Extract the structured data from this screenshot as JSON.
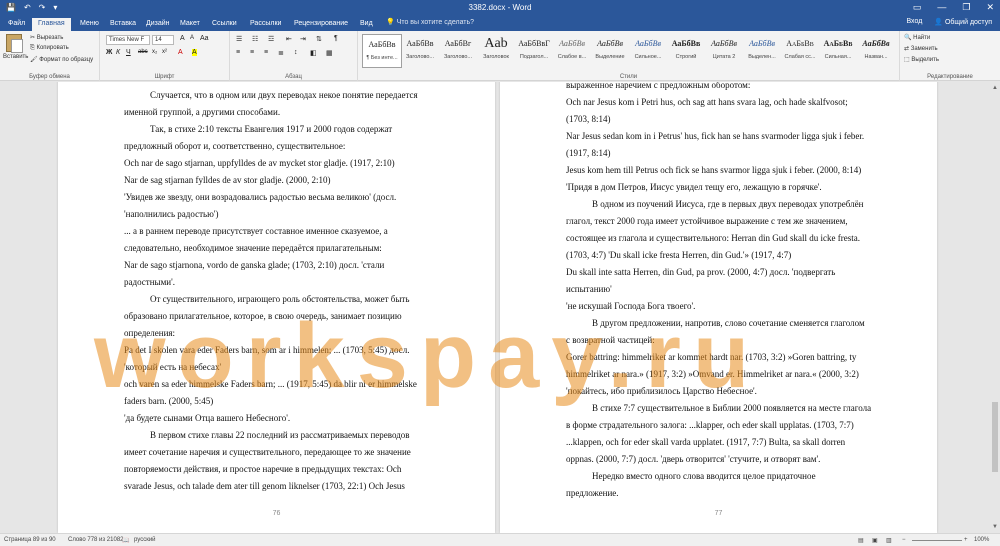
{
  "titlebar": {
    "doc_title": "3382.docx - Word",
    "qat": [
      "💾",
      "↶",
      "↷",
      "▾"
    ],
    "controls": [
      "▭",
      "—",
      "❐",
      "✕"
    ]
  },
  "tabs": [
    "Файл",
    "Главная",
    "Меню",
    "Вставка",
    "Дизайн",
    "Макет",
    "Ссылки",
    "Рассылки",
    "Рецензирование",
    "Вид"
  ],
  "tell_me": "Что вы хотите сделать?",
  "account": {
    "signin": "Вход",
    "share": "Общий доступ"
  },
  "ribbon": {
    "clipboard": {
      "paste": "Вставить",
      "cut": "Вырезать",
      "copy": "Копировать",
      "format": "Формат по образцу",
      "group": "Буфер обмена"
    },
    "font": {
      "name": "Times New F",
      "size": "14",
      "group": "Шрифт",
      "buttons": [
        "Ж",
        "К",
        "Ч",
        "abc",
        "x₂",
        "x²",
        "A",
        "A"
      ]
    },
    "paragraph": {
      "group": "Абзац"
    },
    "styles": {
      "group": "Стили",
      "items": [
        {
          "preview": "АаБбВв",
          "label": "¶ Без инте..."
        },
        {
          "preview": "АаБбВв",
          "label": "Заголово..."
        },
        {
          "preview": "АаБбВг",
          "label": "Заголово..."
        },
        {
          "preview": "Aab",
          "label": "Заголовок"
        },
        {
          "preview": "АаБбВвГ",
          "label": "Подзагол..."
        },
        {
          "preview": "АаБбВв",
          "label": "Слабое в..."
        },
        {
          "preview": "АаБбВв",
          "label": "Выделение"
        },
        {
          "preview": "АаБбВв",
          "label": "Сильное..."
        },
        {
          "preview": "АаБбВв",
          "label": "Строгий"
        },
        {
          "preview": "АаБбВв",
          "label": "Цитата 2"
        },
        {
          "preview": "АаБбВв",
          "label": "Выделен..."
        },
        {
          "preview": "АаБбВв",
          "label": "Слабая сс..."
        },
        {
          "preview": "АаБбВв",
          "label": "Сильная..."
        },
        {
          "preview": "АаБбВв",
          "label": "Назван..."
        }
      ]
    },
    "editing": {
      "find": "Найти",
      "replace": "Заменить",
      "select": "Выделить",
      "group": "Редактирование"
    }
  },
  "page_left": {
    "number": "76",
    "lines": [
      "Случается, что в одном или двух переводах некое понятие передается",
      "именной группой, а другими способами.",
      "Так, в стихе 2:10 тексты Евангелия 1917 и 2000 годов содержат",
      "предложный оборот и, соответственно, существительное:",
      "Och nar de sago stjarnan, uppfylldes de av mycket stor gladje. (1917, 2:10)",
      "Nar de sag stjarnan fylldes de av stor gladje. (2000, 2:10)",
      "'Увидев же звезду, они возрадовались радостью весьма великою' (досл.",
      "'наполнились радостью')",
      "... а в раннем переводе присутствует составное именное сказуемое, а",
      "следовательно, необходимое значение передаётся прилагательным:",
      "Nar de sago stjarnona, vordo de ganska glade; (1703, 2:10) досл. 'стали",
      "радостными'.",
      "От существительного, играющего роль обстоятельства, может быть",
      "образовано прилагательное, которое, в свою очередь, занимает позицию",
      "определения:",
      "Pa det I skolen vara eder Faders barn, som ar i himmelen; ... (1703, 5:45) досл.",
      "'который есть на небесах'",
      "och varen sa eder himmelske Faders barn; ... (1917, 5:45) da blir ni er himmelske",
      "faders barn. (2000, 5:45)",
      "'да будете сынами Отца вашего Небесного'.",
      "В первом стихе главы 22 последний из рассматриваемых переводов",
      "имеет сочетание наречия и существительного, передающее то же значение",
      "повторяемости действия, и простое наречие в предыдущих текстах: Och",
      "svarade Jesus, och talade dem ater till genom liknelser (1703, 22:1) Och Jesus"
    ]
  },
  "page_right": {
    "number": "77",
    "lines": [
      "выраженное наречием с предложным оборотом:",
      "Och nar Jesus kom i Petri hus, och sag att hans svara lag, och hade skalfvosot;",
      "(1703, 8:14)",
      "Nar Jesus sedan kom in i Petrus' hus, fick han se hans svarmoder ligga sjuk i feber.",
      "(1917, 8:14)",
      "Jesus kom hem till Petrus och fick se hans svarmor ligga sjuk i feber. (2000, 8:14)",
      "'Придя в дом Петров, Иисус увидел тещу его, лежащую в горячке'.",
      "В одном из поучений Иисуса, где в первых двух переводах употреблён",
      "глагол, текст 2000 года имеет устойчивое выражение с тем же значением,",
      "состоящее из глагола и существительного: Herran din Gud skall du icke fresta.",
      "(1703, 4:7) 'Du skall icke fresta Herren, din Gud.'» (1917, 4:7)",
      "Du skall inte satta Herren, din Gud, pa prov. (2000, 4:7) досл. 'подвергать",
      "испытанию'",
      "'не искушай Господа Бога твоего'.",
      "В другом предложении, напротив, слово сочетание сменяется глаголом",
      "с возвратной частицей:",
      "Gorer battring: himmelriket ar kommet hardt nar. (1703, 3:2) »Goren battring, ty",
      "himmelriket ar nara.» (1917, 3:2) »Omvand er. Himmelriket ar nara.« (2000, 3:2)",
      "'покайтесь, ибо приблизилось Царство Небесное'.",
      "В стихе 7:7 существительное в Библии 2000 появляется на месте глагола",
      "в форме страдательного залога: ...klapper, och eder skall upplatas. (1703, 7:7)",
      "...klappen, och for eder skall varda upplatet. (1917, 7:7) Bulta, sa skall dorren",
      "oppnas. (2000, 7:7) досл. 'дверь отворится' 'стучите, и отворят вам'.",
      "Нередко вместо одного слова вводится целое придаточное",
      "предложение."
    ]
  },
  "watermark": "workspay.ru",
  "status": {
    "page": "Страница 89 из 90",
    "words": "Слово 778 из 21082",
    "lang": "русский",
    "zoom": "100%"
  }
}
